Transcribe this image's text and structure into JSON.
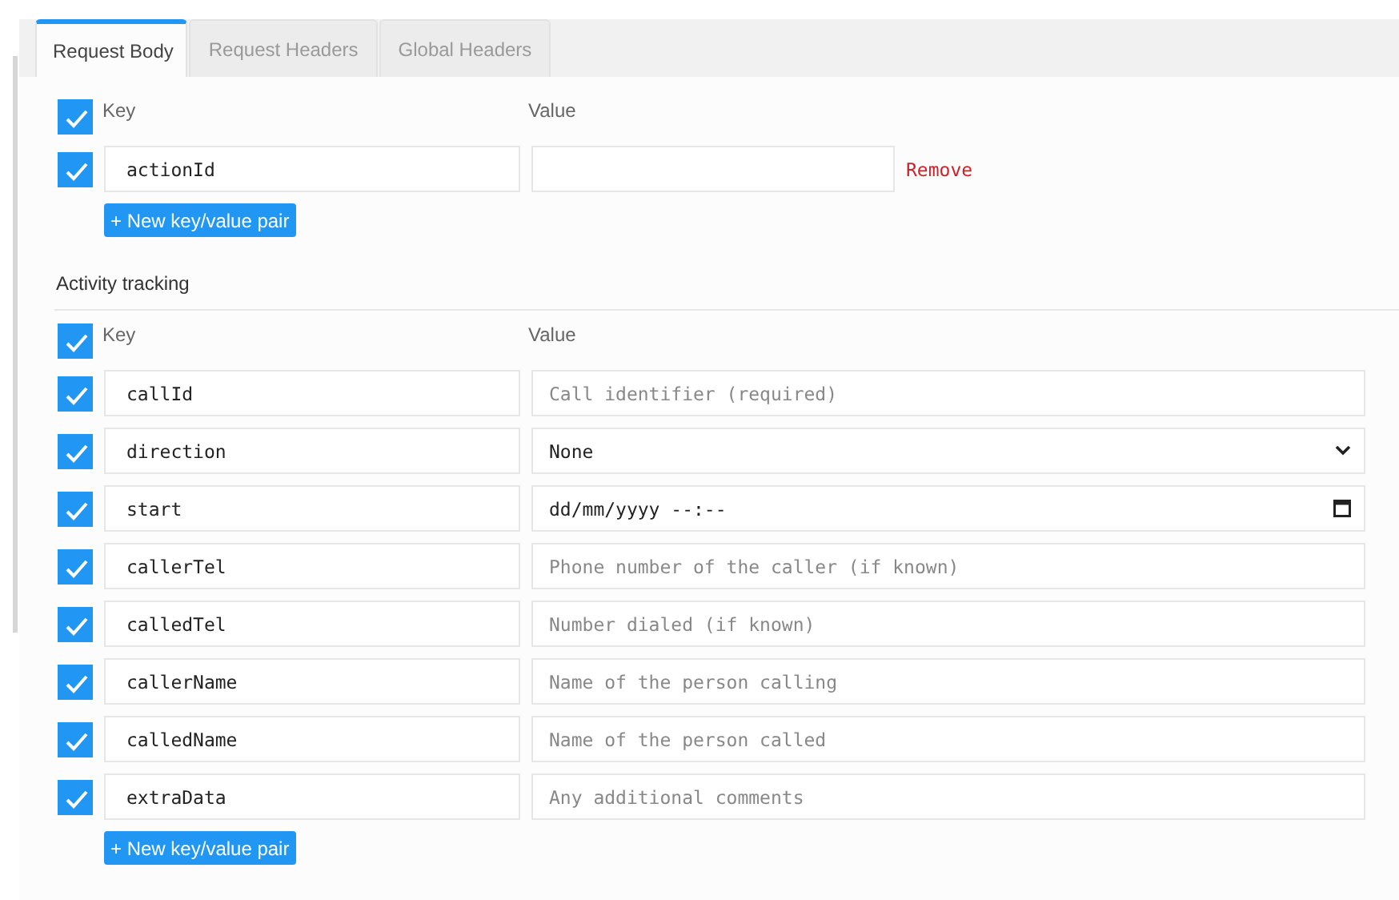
{
  "tabs": [
    {
      "label": "Request Body",
      "selected": true
    },
    {
      "label": "Request Headers",
      "selected": false
    },
    {
      "label": "Global Headers",
      "selected": false
    }
  ],
  "sections": [
    {
      "key_header": "Key",
      "value_header": "Value",
      "header_checked": true,
      "rows": [
        {
          "checked": true,
          "key": "actionId",
          "kind": "text",
          "action": "Remove"
        }
      ],
      "add_button": "+ New key/value pair"
    },
    {
      "title": "Activity tracking",
      "key_header": "Key",
      "value_header": "Value",
      "header_checked": true,
      "rows": [
        {
          "checked": true,
          "key": "callId",
          "kind": "text",
          "placeholder": "Call identifier (required)"
        },
        {
          "checked": true,
          "key": "direction",
          "kind": "select",
          "value": "None"
        },
        {
          "checked": true,
          "key": "start",
          "kind": "datetime",
          "value": "dd/mm/yyyy --:--"
        },
        {
          "checked": true,
          "key": "callerTel",
          "kind": "text",
          "placeholder": "Phone number of the caller (if known)"
        },
        {
          "checked": true,
          "key": "calledTel",
          "kind": "text",
          "placeholder": "Number dialed (if known)"
        },
        {
          "checked": true,
          "key": "callerName",
          "kind": "text",
          "placeholder": "Name of the person calling"
        },
        {
          "checked": true,
          "key": "calledName",
          "kind": "text",
          "placeholder": "Name of the person called"
        },
        {
          "checked": true,
          "key": "extraData",
          "kind": "text",
          "placeholder": "Any additional comments"
        }
      ],
      "add_button": "+ New key/value pair"
    }
  ]
}
